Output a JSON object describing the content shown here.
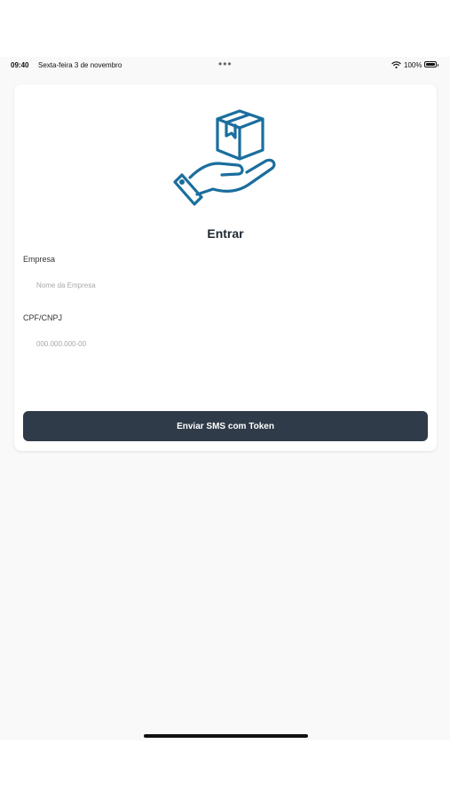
{
  "status_bar": {
    "time": "09:40",
    "date": "Sexta-feira 3 de novembro",
    "dots": "•••",
    "battery_label": "100%",
    "battery_level": 1.0
  },
  "login": {
    "title": "Entrar",
    "company": {
      "label": "Empresa",
      "placeholder": "Nome da Empresa",
      "value": ""
    },
    "document": {
      "label": "CPF/CNPJ",
      "placeholder": "000.000.000-00",
      "value": ""
    },
    "submit_label": "Enviar SMS com Token"
  },
  "icons": {
    "logo": "hand-holding-box-icon",
    "wifi": "wifi-icon",
    "battery": "battery-icon"
  },
  "colors": {
    "background": "#f9f9f9",
    "card": "#ffffff",
    "logo": "#1a6e9e",
    "button": "#2f3b48",
    "button_text": "#ffffff",
    "title": "#1f2933"
  }
}
